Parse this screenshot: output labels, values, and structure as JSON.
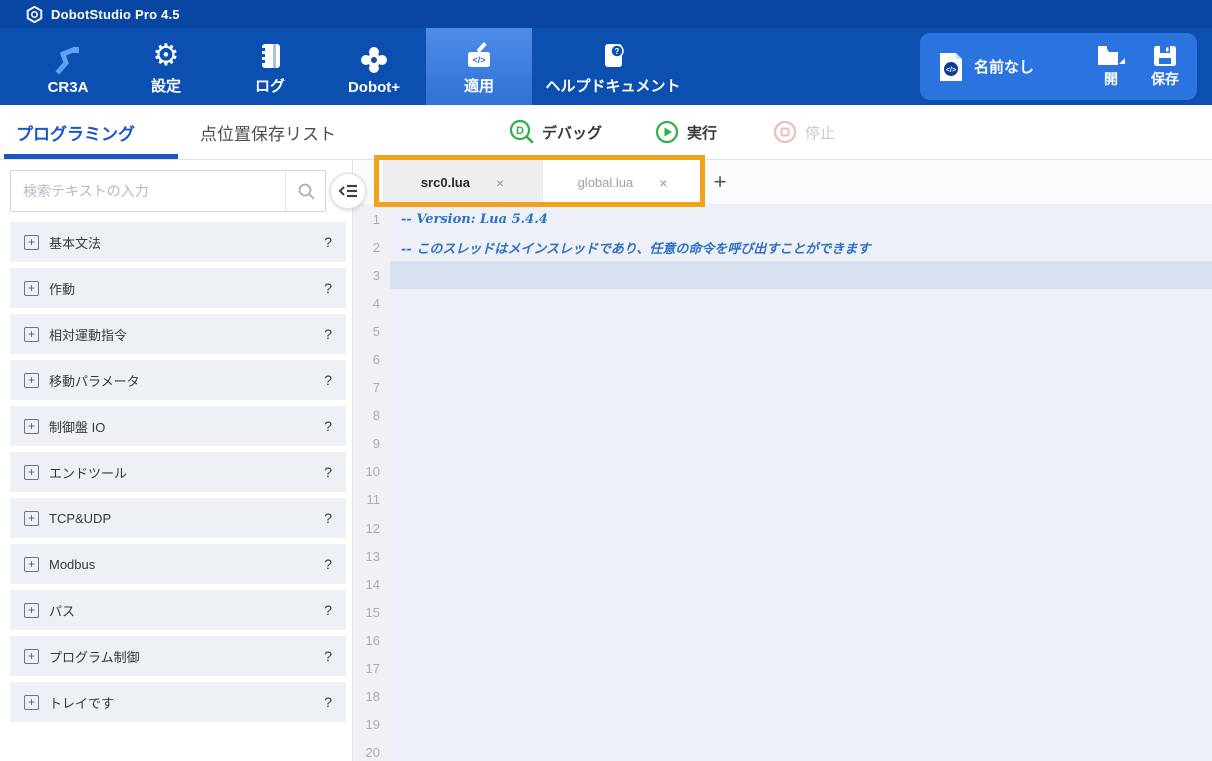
{
  "app": {
    "title": "DobotStudio Pro 4.5"
  },
  "nav": {
    "items": [
      {
        "label": "CR3A",
        "icon": "robot-arm-icon",
        "active": false
      },
      {
        "label": "設定",
        "icon": "gear-icon",
        "active": false
      },
      {
        "label": "ログ",
        "icon": "log-icon",
        "active": false
      },
      {
        "label": "Dobot+",
        "icon": "puzzle-icon",
        "active": false
      },
      {
        "label": "適用",
        "icon": "apply-icon",
        "active": true
      },
      {
        "label": "ヘルプドキュメント",
        "icon": "help-doc-icon",
        "active": false
      }
    ],
    "file_panel": {
      "file_name": "名前なし",
      "open_label": "開",
      "save_label": "保存"
    }
  },
  "toolbar": {
    "tabs": [
      {
        "label": "プログラミング",
        "active": true
      },
      {
        "label": "点位置保存リスト",
        "active": false
      }
    ],
    "actions": [
      {
        "label": "デバッグ",
        "state": "enabled"
      },
      {
        "label": "実行",
        "state": "enabled"
      },
      {
        "label": "停止",
        "state": "disabled"
      }
    ]
  },
  "sidebar": {
    "search_placeholder": "検索テキストの入力",
    "expand_glyph": "+",
    "help_glyph": "?",
    "items": [
      {
        "label": "基本文法"
      },
      {
        "label": "作動"
      },
      {
        "label": "相対運動指令"
      },
      {
        "label": "移動パラメータ"
      },
      {
        "label": "制御盤 IO"
      },
      {
        "label": "エンドツール"
      },
      {
        "label": "TCP&UDP"
      },
      {
        "label": "Modbus"
      },
      {
        "label": "パス"
      },
      {
        "label": "プログラム制御"
      },
      {
        "label": "トレイです"
      }
    ]
  },
  "editor": {
    "tabs": [
      {
        "label": "src0.lua",
        "active": true
      },
      {
        "label": "global.lua",
        "active": false
      }
    ],
    "close_glyph": "×",
    "new_tab_glyph": "+",
    "line_count": 20,
    "highlighted_line": 3,
    "lines": [
      {
        "number": 1,
        "code": "-- Version: Lua 5.4.4"
      },
      {
        "number": 2,
        "code": "-- このスレッドはメインスレッドであり、任意の命令を呼び出すことができます"
      }
    ]
  },
  "colors": {
    "titlebar_blue": "#0945a3",
    "navbar_blue": "#0b4fb0",
    "nav_active_blue": "#3c7ede",
    "file_panel_blue": "#2b74e0",
    "accent_blue": "#1a57c2",
    "annotation_orange": "#f0a11e",
    "run_green": "#2fb043",
    "stop_pink": "#edbcbc",
    "code_comment_blue": "#2e72c4",
    "line_highlight": "#d9e1f1"
  }
}
